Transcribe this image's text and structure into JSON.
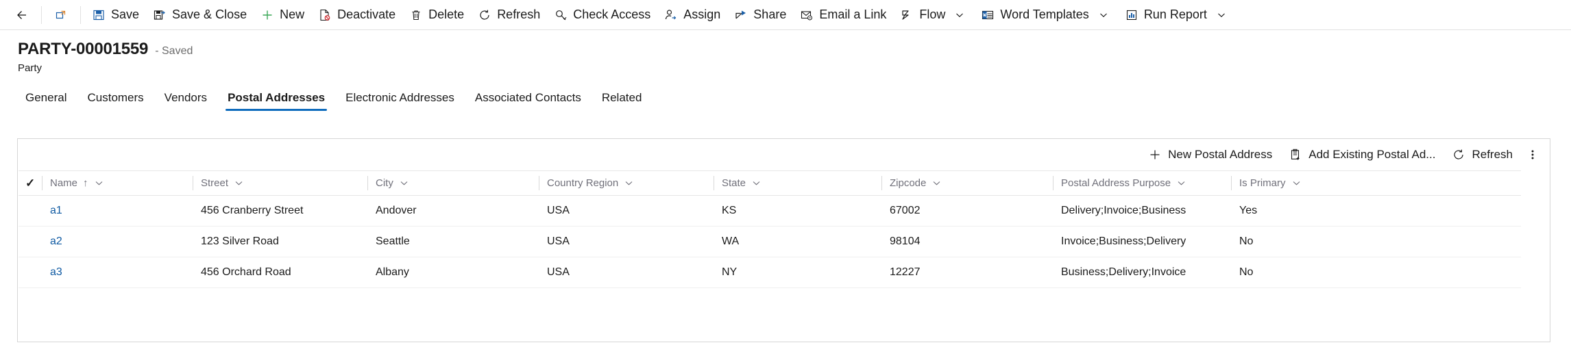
{
  "toolbar": {
    "back_label": "",
    "popout_label": "",
    "items": [
      {
        "icon": "save-icon",
        "label": "Save"
      },
      {
        "icon": "save-close-icon",
        "label": "Save & Close"
      },
      {
        "icon": "plus-icon",
        "label": "New"
      },
      {
        "icon": "deactivate-icon",
        "label": "Deactivate"
      },
      {
        "icon": "trash-icon",
        "label": "Delete"
      },
      {
        "icon": "refresh-icon",
        "label": "Refresh"
      },
      {
        "icon": "check-access-icon",
        "label": "Check Access"
      },
      {
        "icon": "assign-icon",
        "label": "Assign"
      },
      {
        "icon": "share-icon",
        "label": "Share"
      },
      {
        "icon": "email-link-icon",
        "label": "Email a Link"
      },
      {
        "icon": "flow-icon",
        "label": "Flow",
        "chevron": true
      },
      {
        "icon": "word-templates-icon",
        "label": "Word Templates",
        "chevron": true
      },
      {
        "icon": "run-report-icon",
        "label": "Run Report",
        "chevron": true
      }
    ]
  },
  "header": {
    "record_title": "PARTY-00001559",
    "status": "- Saved",
    "entity_name": "Party"
  },
  "tabs": [
    {
      "label": "General",
      "active": false
    },
    {
      "label": "Customers",
      "active": false
    },
    {
      "label": "Vendors",
      "active": false
    },
    {
      "label": "Postal Addresses",
      "active": true
    },
    {
      "label": "Electronic Addresses",
      "active": false
    },
    {
      "label": "Associated Contacts",
      "active": false
    },
    {
      "label": "Related",
      "active": false
    }
  ],
  "subgrid": {
    "commands": [
      {
        "icon": "plus-icon",
        "label": "New Postal Address"
      },
      {
        "icon": "add-existing-icon",
        "label": "Add Existing Postal Ad..."
      },
      {
        "icon": "refresh-icon",
        "label": "Refresh"
      }
    ],
    "overflow_label": "More commands",
    "select_all_label": "Select all rows",
    "columns": [
      {
        "label": "Name",
        "sorted": true,
        "sort_arrow": "↑"
      },
      {
        "label": "Street",
        "sorted": false,
        "sort_arrow": ""
      },
      {
        "label": "City",
        "sorted": false,
        "sort_arrow": ""
      },
      {
        "label": "Country Region",
        "sorted": false,
        "sort_arrow": ""
      },
      {
        "label": "State",
        "sorted": false,
        "sort_arrow": ""
      },
      {
        "label": "Zipcode",
        "sorted": false,
        "sort_arrow": ""
      },
      {
        "label": "Postal Address Purpose",
        "sorted": false,
        "sort_arrow": ""
      },
      {
        "label": "Is Primary",
        "sorted": false,
        "sort_arrow": ""
      }
    ],
    "rows": [
      {
        "name": "a1",
        "street": "456 Cranberry Street",
        "city": "Andover",
        "country_region": "USA",
        "state": "KS",
        "zipcode": "67002",
        "purpose": "Delivery;Invoice;Business",
        "is_primary": "Yes"
      },
      {
        "name": "a2",
        "street": "123 Silver Road",
        "city": "Seattle",
        "country_region": "USA",
        "state": "WA",
        "zipcode": "98104",
        "purpose": "Invoice;Business;Delivery",
        "is_primary": "No"
      },
      {
        "name": "a3",
        "street": "456 Orchard Road",
        "city": "Albany",
        "country_region": "USA",
        "state": "NY",
        "zipcode": "12227",
        "purpose": "Business;Delivery;Invoice",
        "is_primary": "No"
      }
    ]
  },
  "colors": {
    "accent": "#0f6cbd",
    "link": "#0f5aa2",
    "text": "#1b1b1b",
    "muted": "#70707a",
    "border": "#d6d6d6",
    "danger": "#d13438",
    "success": "#107c10"
  }
}
